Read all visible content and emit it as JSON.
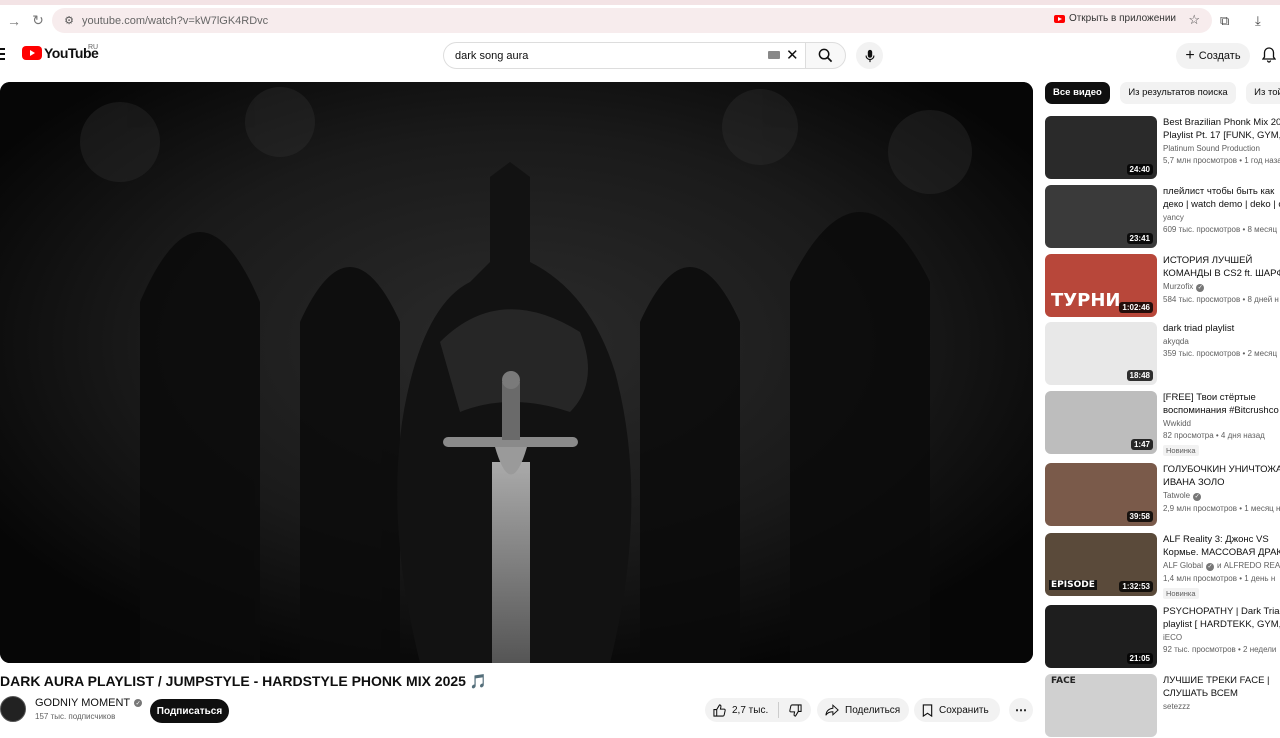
{
  "browser": {
    "url": "youtube.com/watch?v=kW7lGK4RDvc",
    "open_in_app": "Открыть в приложении"
  },
  "header": {
    "logo_text": "YouTube",
    "region": "RU",
    "search_value": "dark song aura",
    "create_label": "Создать"
  },
  "video": {
    "title": "DARK AURA PLAYLIST / JUMPSTYLE - HARDSTYLE PHONK MIX 2025 🎵",
    "channel": "GODNIY MOMENT",
    "subscribers": "157 тыс. подписчиков",
    "subscribe_label": "Подписаться",
    "likes": "2,7 тыс.",
    "share_label": "Поделиться",
    "save_label": "Сохранить",
    "more_label": "⋯"
  },
  "chips": [
    "Все видео",
    "Из результатов поиска",
    "Из той"
  ],
  "related": [
    {
      "title1": "Best Brazilian Phonk Mix 20",
      "title2": "Playlist Pt. 17 [FUNK, GYM, .",
      "channel": "Platinum Sound Production",
      "meta": "5,7 млн просмотров • 1 год назад",
      "duration": "24:40",
      "badge": "",
      "thumb": "#2a2a2a"
    },
    {
      "title1": "плейлист чтобы быть как",
      "title2": "деко | watch demo | deko | c",
      "channel": "yancy",
      "meta": "609 тыс. просмотров • 8 месяц",
      "duration": "23:41",
      "badge": "",
      "thumb": "#3a3a3a"
    },
    {
      "title1": "ИСТОРИЯ ЛУЧШЕЙ",
      "title2": "КОМАНДЫ В CS2 ft. ШАРФ",
      "channel": "Murzofix",
      "meta": "584 тыс. просмотров • 8 дней н",
      "duration": "1:02:46",
      "badge": "",
      "thumb": "#b8473a",
      "overlay": "ТУРНИ"
    },
    {
      "title1": "dark triad playlist",
      "title2": "",
      "channel": "akyqda",
      "meta": "359 тыс. просмотров • 2 месяц",
      "duration": "18:48",
      "badge": "",
      "thumb": "#e8e8e8"
    },
    {
      "title1": "[FREE] Твои стёртые",
      "title2": "воспоминания #Bitcrushco",
      "channel": "Wwkidd",
      "meta": "82 просмотра • 4 дня назад",
      "duration": "1:47",
      "badge": "Новинка",
      "thumb": "#bdbdbd"
    },
    {
      "title1": "ГОЛУБОЧКИН УНИЧТОЖА",
      "title2": "ИВАНА ЗОЛО",
      "channel": "Tatwole",
      "meta": "2,9 млн просмотров • 1 месяц н",
      "duration": "39:58",
      "badge": "",
      "thumb": "#7a5a4a"
    },
    {
      "title1": "ALF Reality 3: Джонс VS",
      "title2": "Кормье. МАССОВАЯ ДРАК",
      "channel": "ALF Global",
      "channel_extra": "и ALFREDO REAL",
      "meta": "1,4 млн просмотров • 1 день н",
      "duration": "1:32:53",
      "badge": "Новинка",
      "thumb": "#5a4a3a",
      "overlay": "EPISODE"
    },
    {
      "title1": "PSYCHOPATHY | Dark Triad",
      "title2": "playlist [ HARDTEKK, GYM, .",
      "channel": "iECO",
      "meta": "92 тыс. просмотров • 2 недели",
      "duration": "21:05",
      "badge": "",
      "thumb": "#1e1e1e"
    },
    {
      "title1": "ЛУЧШИЕ ТРЕКИ FACE |",
      "title2": "СЛУШАТЬ ВСЕМ",
      "channel": "setezzz",
      "meta": "",
      "duration": "",
      "badge": "",
      "thumb": "#d0d0d0",
      "overlay": "FACE"
    }
  ]
}
